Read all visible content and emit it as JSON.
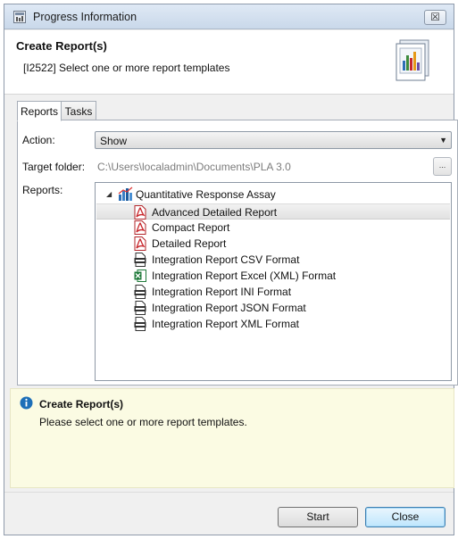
{
  "window": {
    "title": "Progress Information",
    "close_glyph": "☒"
  },
  "header": {
    "title": "Create Report(s)",
    "subtitle": "[I2522] Select one or more report templates",
    "icon": "report-chart-icon"
  },
  "tabs": [
    {
      "label": "Reports",
      "active": true
    },
    {
      "label": "Tasks",
      "active": false
    }
  ],
  "form": {
    "action_label": "Action:",
    "action_value": "Show",
    "target_label": "Target folder:",
    "target_value": "C:\\Users\\localadmin\\Documents\\PLA 3.0",
    "browse_label": "...",
    "reports_label": "Reports:"
  },
  "tree": {
    "root": {
      "label": "Quantitative Response Assay",
      "icon": "assay-chart-icon",
      "expanded": true
    },
    "items": [
      {
        "label": "Advanced Detailed Report",
        "icon": "pdf-icon",
        "selected": true
      },
      {
        "label": "Compact Report",
        "icon": "pdf-icon",
        "selected": false
      },
      {
        "label": "Detailed Report",
        "icon": "pdf-icon",
        "selected": false
      },
      {
        "label": "Integration Report CSV Format",
        "icon": "csv-file-icon",
        "selected": false
      },
      {
        "label": "Integration Report Excel (XML) Format",
        "icon": "excel-icon",
        "selected": false
      },
      {
        "label": "Integration Report INI Format",
        "icon": "ini-file-icon",
        "selected": false
      },
      {
        "label": "Integration Report JSON Format",
        "icon": "json-file-icon",
        "selected": false
      },
      {
        "label": "Integration Report XML Format",
        "icon": "xml-file-icon",
        "selected": false
      }
    ]
  },
  "info": {
    "title": "Create Report(s)",
    "text": "Please select one or more report templates.",
    "icon": "info-icon"
  },
  "footer": {
    "start_label": "Start",
    "close_label": "Close"
  },
  "colors": {
    "accent": "#1d6fb8",
    "pdf_red": "#c8262b",
    "excel_green": "#1f7a3a",
    "info_bg": "#fbfbe3"
  }
}
